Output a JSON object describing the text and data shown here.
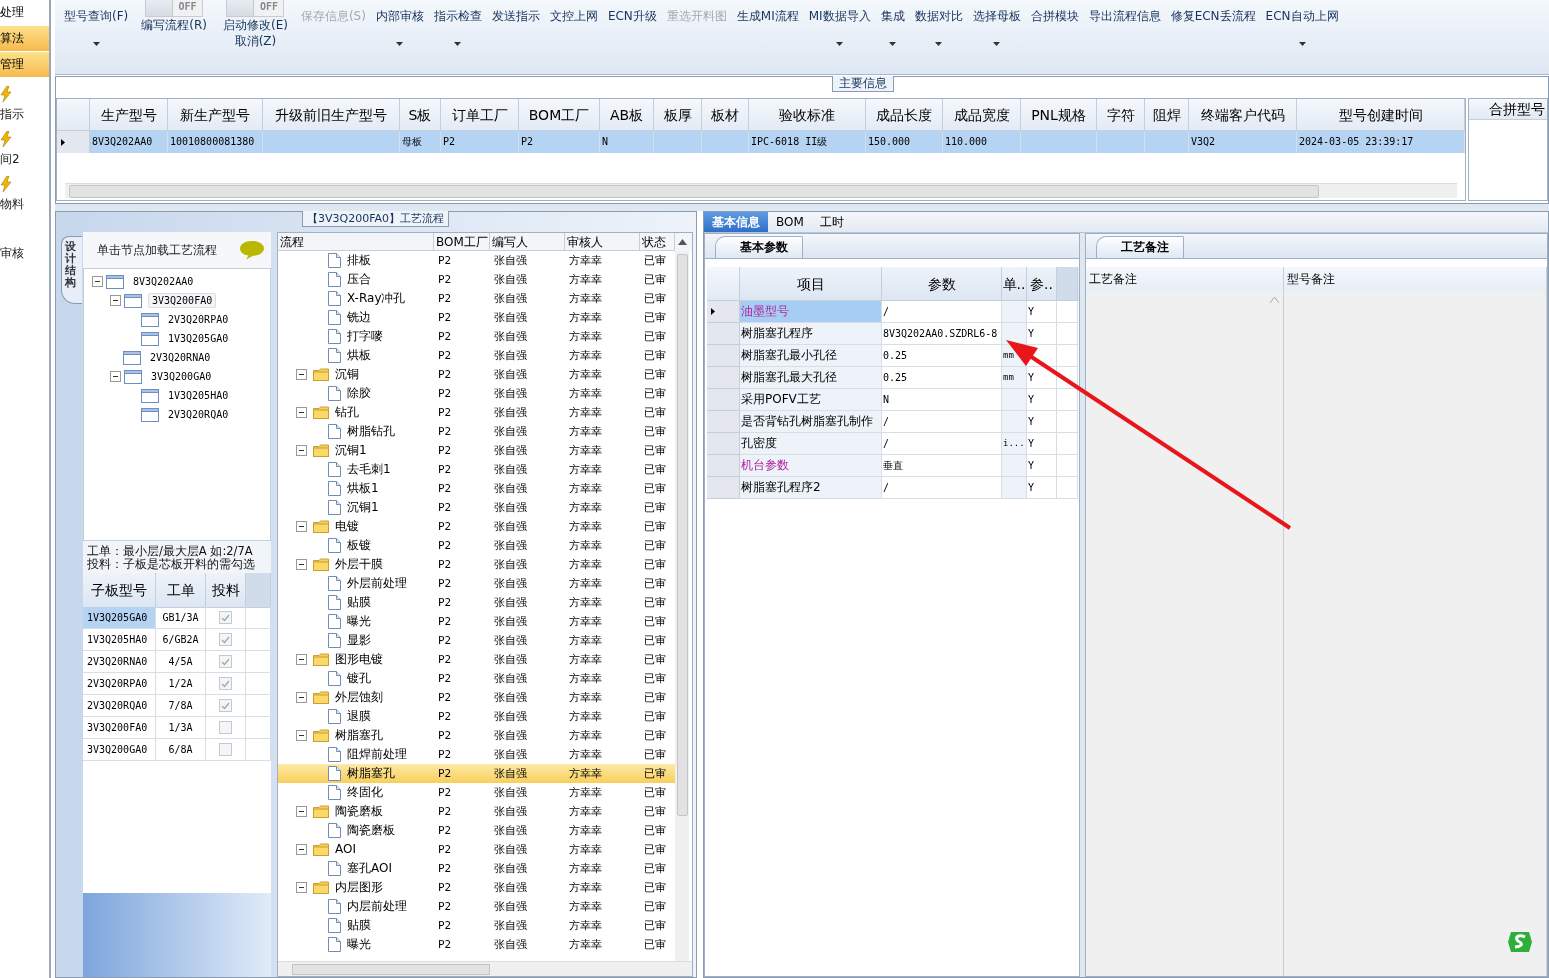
{
  "side_strip": {
    "menu": [
      {
        "label": "处理",
        "highlighted": false
      },
      {
        "label": "算法",
        "highlighted": true
      },
      {
        "label": "管理",
        "highlighted": true
      }
    ],
    "tasks": [
      {
        "label": "指示",
        "icon": true
      },
      {
        "label": "间2",
        "icon": true
      },
      {
        "label": "物料",
        "icon": true
      },
      {
        "label": "审核",
        "icon": false
      }
    ]
  },
  "toolbar": [
    {
      "kind": "button",
      "label": "型号查询(F)",
      "menu": true,
      "disabled": false
    },
    {
      "kind": "toggle",
      "switch": "OFF",
      "on": false,
      "label": "编写流程(R)"
    },
    {
      "kind": "toggle",
      "switch": "OFF",
      "on": false,
      "label": "启动修改(E)",
      "sublabel": "取消(Z)"
    },
    {
      "kind": "button",
      "label": "保存信息(S)",
      "menu": false,
      "disabled": true
    },
    {
      "kind": "button",
      "label": "内部审核",
      "menu": true,
      "disabled": false
    },
    {
      "kind": "button",
      "label": "指示检查",
      "menu": true,
      "disabled": false
    },
    {
      "kind": "button",
      "label": "发送指示",
      "menu": false,
      "disabled": false
    },
    {
      "kind": "button",
      "label": "文控上网",
      "menu": false,
      "disabled": false
    },
    {
      "kind": "button",
      "label": "ECN升级",
      "menu": false,
      "disabled": false
    },
    {
      "kind": "button",
      "label": "重选开料图",
      "menu": false,
      "disabled": true
    },
    {
      "kind": "button",
      "label": "生成MI流程",
      "menu": false,
      "disabled": false
    },
    {
      "kind": "button",
      "label": "MI数据导入",
      "menu": true,
      "disabled": false
    },
    {
      "kind": "button",
      "label": "集成",
      "menu": true,
      "disabled": false
    },
    {
      "kind": "button",
      "label": "数据对比",
      "menu": true,
      "disabled": false
    },
    {
      "kind": "button",
      "label": "选择母板",
      "menu": true,
      "disabled": false
    },
    {
      "kind": "button",
      "label": "合拼模块",
      "menu": false,
      "disabled": false
    },
    {
      "kind": "button",
      "label": "导出流程信息",
      "menu": false,
      "disabled": false
    },
    {
      "kind": "button",
      "label": "修复ECN丢流程",
      "menu": false,
      "disabled": false
    },
    {
      "kind": "button",
      "label": "ECN自动上网",
      "menu": true,
      "disabled": false
    }
  ],
  "main_info": {
    "title": "主要信息",
    "columns": [
      "生产型号",
      "新生产型号",
      "升级前旧生产型号",
      "S板",
      "订单工厂",
      "BOM工厂",
      "AB板",
      "板厚",
      "板材",
      "验收标准",
      "成品长度",
      "成品宽度",
      "PNL规格",
      "字符",
      "阻焊",
      "终端客户代码",
      "型号创建时间"
    ],
    "rows": [
      {
        "selected": true,
        "cells": [
          "8V3Q202AA0",
          "10010800081380",
          "",
          "母板",
          "P2",
          "P2",
          "N",
          "",
          "",
          "IPC-6018 II级",
          "150.000",
          "110.000",
          "",
          "",
          "",
          "V3Q2",
          "2024-03-05 23:39:17"
        ]
      }
    ],
    "side_column": "合拼型号"
  },
  "structure_panel": {
    "tab": "设计结构",
    "hint": "单击节点加载工艺流程",
    "tree": [
      {
        "label": "8V3Q202AA0",
        "expanded": true,
        "selected": false,
        "children": [
          {
            "label": "3V3Q200FA0",
            "expanded": true,
            "selected": true,
            "children": [
              {
                "label": "2V3Q20RPA0",
                "selected": false
              },
              {
                "label": "1V3Q205GA0",
                "selected": false
              }
            ]
          },
          {
            "label": "2V3Q20RNA0",
            "selected": false
          },
          {
            "label": "3V3Q200GA0",
            "expanded": true,
            "selected": false,
            "children": [
              {
                "label": "1V3Q205HA0",
                "selected": false
              },
              {
                "label": "2V3Q20RQA0",
                "selected": false
              }
            ]
          }
        ]
      }
    ],
    "notes": [
      "工单：最小层/最大层A 如:2/7A",
      "投料：子板是芯板开料的需勾选"
    ],
    "columns": [
      "子板型号",
      "工单",
      "投料"
    ],
    "rows": [
      {
        "board": "1V3Q205GA0",
        "order": "GB1/3A",
        "checked": true,
        "selected": true
      },
      {
        "board": "1V3Q205HA0",
        "order": "6/GB2A",
        "checked": true,
        "selected": false
      },
      {
        "board": "2V3Q20RNA0",
        "order": "4/5A",
        "checked": true,
        "selected": false
      },
      {
        "board": "2V3Q20RPA0",
        "order": "1/2A",
        "checked": true,
        "selected": false
      },
      {
        "board": "2V3Q20RQA0",
        "order": "7/8A",
        "checked": true,
        "selected": false
      },
      {
        "board": "3V3Q200FA0",
        "order": "1/3A",
        "checked": false,
        "selected": false
      },
      {
        "board": "3V3Q200GA0",
        "order": "6/8A",
        "checked": false,
        "selected": false
      }
    ]
  },
  "flow": {
    "title": "【3V3Q200FA0】工艺流程",
    "columns": [
      "流程",
      "BOM工厂",
      "编写人",
      "审核人",
      "状态"
    ],
    "items": [
      {
        "kind": "step",
        "name": "排板",
        "factory": "P2",
        "author": "张自强",
        "reviewer": "方幸幸",
        "status": "已审",
        "selected": false
      },
      {
        "kind": "step",
        "name": "压合",
        "factory": "P2",
        "author": "张自强",
        "reviewer": "方幸幸",
        "status": "已审",
        "selected": false
      },
      {
        "kind": "step",
        "name": "X-Ray冲孔",
        "factory": "P2",
        "author": "张自强",
        "reviewer": "方幸幸",
        "status": "已审",
        "selected": false
      },
      {
        "kind": "step",
        "name": "铣边",
        "factory": "P2",
        "author": "张自强",
        "reviewer": "方幸幸",
        "status": "已审",
        "selected": false
      },
      {
        "kind": "step",
        "name": "打字嘜",
        "factory": "P2",
        "author": "张自强",
        "reviewer": "方幸幸",
        "status": "已审",
        "selected": false
      },
      {
        "kind": "step",
        "name": "烘板",
        "factory": "P2",
        "author": "张自强",
        "reviewer": "方幸幸",
        "status": "已审",
        "selected": false
      },
      {
        "kind": "group",
        "name": "沉铜",
        "factory": "P2",
        "author": "张自强",
        "reviewer": "方幸幸",
        "status": "已审",
        "selected": false,
        "expanded": true,
        "children": [
          {
            "kind": "step",
            "name": "除胶",
            "factory": "P2",
            "author": "张自强",
            "reviewer": "方幸幸",
            "status": "已审",
            "selected": false
          }
        ]
      },
      {
        "kind": "group",
        "name": "钻孔",
        "factory": "P2",
        "author": "张自强",
        "reviewer": "方幸幸",
        "status": "已审",
        "selected": false,
        "expanded": true,
        "children": [
          {
            "kind": "step",
            "name": "树脂钻孔",
            "factory": "P2",
            "author": "张自强",
            "reviewer": "方幸幸",
            "status": "已审",
            "selected": false
          }
        ]
      },
      {
        "kind": "group",
        "name": "沉铜1",
        "factory": "P2",
        "author": "张自强",
        "reviewer": "方幸幸",
        "status": "已审",
        "selected": false,
        "expanded": true,
        "children": [
          {
            "kind": "step",
            "name": "去毛刺1",
            "factory": "P2",
            "author": "张自强",
            "reviewer": "方幸幸",
            "status": "已审",
            "selected": false
          },
          {
            "kind": "step",
            "name": "烘板1",
            "factory": "P2",
            "author": "张自强",
            "reviewer": "方幸幸",
            "status": "已审",
            "selected": false
          },
          {
            "kind": "step",
            "name": "沉铜1",
            "factory": "P2",
            "author": "张自强",
            "reviewer": "方幸幸",
            "status": "已审",
            "selected": false
          }
        ]
      },
      {
        "kind": "group",
        "name": "电镀",
        "factory": "P2",
        "author": "张自强",
        "reviewer": "方幸幸",
        "status": "已审",
        "selected": false,
        "expanded": true,
        "children": [
          {
            "kind": "step",
            "name": "板镀",
            "factory": "P2",
            "author": "张自强",
            "reviewer": "方幸幸",
            "status": "已审",
            "selected": false
          }
        ]
      },
      {
        "kind": "group",
        "name": "外层干膜",
        "factory": "P2",
        "author": "张自强",
        "reviewer": "方幸幸",
        "status": "已审",
        "selected": false,
        "expanded": true,
        "children": [
          {
            "kind": "step",
            "name": "外层前处理",
            "factory": "P2",
            "author": "张自强",
            "reviewer": "方幸幸",
            "status": "已审",
            "selected": false
          },
          {
            "kind": "step",
            "name": "贴膜",
            "factory": "P2",
            "author": "张自强",
            "reviewer": "方幸幸",
            "status": "已审",
            "selected": false
          },
          {
            "kind": "step",
            "name": "曝光",
            "factory": "P2",
            "author": "张自强",
            "reviewer": "方幸幸",
            "status": "已审",
            "selected": false
          },
          {
            "kind": "step",
            "name": "显影",
            "factory": "P2",
            "author": "张自强",
            "reviewer": "方幸幸",
            "status": "已审",
            "selected": false
          }
        ]
      },
      {
        "kind": "group",
        "name": "图形电镀",
        "factory": "P2",
        "author": "张自强",
        "reviewer": "方幸幸",
        "status": "已审",
        "selected": false,
        "expanded": true,
        "children": [
          {
            "kind": "step",
            "name": "镀孔",
            "factory": "P2",
            "author": "张自强",
            "reviewer": "方幸幸",
            "status": "已审",
            "selected": false
          }
        ]
      },
      {
        "kind": "group",
        "name": "外层蚀刻",
        "factory": "P2",
        "author": "张自强",
        "reviewer": "方幸幸",
        "status": "已审",
        "selected": false,
        "expanded": true,
        "children": [
          {
            "kind": "step",
            "name": "退膜",
            "factory": "P2",
            "author": "张自强",
            "reviewer": "方幸幸",
            "status": "已审",
            "selected": false
          }
        ]
      },
      {
        "kind": "group",
        "name": "树脂塞孔",
        "factory": "P2",
        "author": "张自强",
        "reviewer": "方幸幸",
        "status": "已审",
        "selected": false,
        "expanded": true,
        "children": [
          {
            "kind": "step",
            "name": "阻焊前处理",
            "factory": "P2",
            "author": "张自强",
            "reviewer": "方幸幸",
            "status": "已审",
            "selected": false
          },
          {
            "kind": "step",
            "name": "树脂塞孔",
            "factory": "P2",
            "author": "张自强",
            "reviewer": "方幸幸",
            "status": "已审",
            "selected": true
          },
          {
            "kind": "step",
            "name": "终固化",
            "factory": "P2",
            "author": "张自强",
            "reviewer": "方幸幸",
            "status": "已审",
            "selected": false
          }
        ]
      },
      {
        "kind": "group",
        "name": "陶瓷磨板",
        "factory": "P2",
        "author": "张自强",
        "reviewer": "方幸幸",
        "status": "已审",
        "selected": false,
        "expanded": true,
        "children": [
          {
            "kind": "step",
            "name": "陶瓷磨板",
            "factory": "P2",
            "author": "张自强",
            "reviewer": "方幸幸",
            "status": "已审",
            "selected": false
          }
        ]
      },
      {
        "kind": "group",
        "name": "AOI",
        "factory": "P2",
        "author": "张自强",
        "reviewer": "方幸幸",
        "status": "已审",
        "selected": false,
        "expanded": true,
        "children": [
          {
            "kind": "step",
            "name": "塞孔AOI",
            "factory": "P2",
            "author": "张自强",
            "reviewer": "方幸幸",
            "status": "已审",
            "selected": false
          }
        ]
      },
      {
        "kind": "group",
        "name": "内层图形",
        "factory": "P2",
        "author": "张自强",
        "reviewer": "方幸幸",
        "status": "已审",
        "selected": false,
        "expanded": true,
        "children": [
          {
            "kind": "step",
            "name": "内层前处理",
            "factory": "P2",
            "author": "张自强",
            "reviewer": "方幸幸",
            "status": "已审",
            "selected": false
          },
          {
            "kind": "step",
            "name": "贴膜",
            "factory": "P2",
            "author": "张自强",
            "reviewer": "方幸幸",
            "status": "已审",
            "selected": false
          },
          {
            "kind": "step",
            "name": "曝光",
            "factory": "P2",
            "author": "张自强",
            "reviewer": "方幸幸",
            "status": "已审",
            "selected": false
          }
        ]
      }
    ]
  },
  "detail_tabs": [
    {
      "label": "基本信息",
      "selected": true
    },
    {
      "label": "BOM",
      "selected": false
    },
    {
      "label": "工时",
      "selected": false
    }
  ],
  "params": {
    "tab": "基本参数",
    "columns": [
      "项目",
      "参数",
      "单..",
      "参.."
    ],
    "rows": [
      {
        "item": "油墨型号",
        "value": "/",
        "unit": "",
        "flag": "Y",
        "emphasized": true,
        "selected": true
      },
      {
        "item": "树脂塞孔程序",
        "value": "8V3Q202AA0.SZDRL6-8",
        "unit": "",
        "flag": "Y",
        "emphasized": false,
        "selected": false
      },
      {
        "item": "树脂塞孔最小孔径",
        "value": "0.25",
        "unit": "mm",
        "emphasized": false,
        "selected": false
      },
      {
        "item": "树脂塞孔最大孔径",
        "value": "0.25",
        "unit": "mm",
        "flag": "Y",
        "emphasized": false,
        "selected": false
      },
      {
        "item": "采用POFV工艺",
        "value": "N",
        "unit": "",
        "flag": "Y",
        "emphasized": false,
        "selected": false
      },
      {
        "item": "是否背钻孔树脂塞孔制作",
        "value": "/",
        "unit": "",
        "flag": "Y",
        "emphasized": false,
        "selected": false
      },
      {
        "item": "孔密度",
        "value": "/",
        "unit": "i...",
        "flag": "Y",
        "emphasized": false,
        "selected": false
      },
      {
        "item": "机台参数",
        "value": "垂直",
        "unit": "",
        "flag": "Y",
        "emphasized": true,
        "selected": false
      },
      {
        "item": "树脂塞孔程序2",
        "value": "/",
        "unit": "",
        "flag": "Y",
        "emphasized": false,
        "selected": false
      }
    ]
  },
  "remarks": {
    "tab": "工艺备注",
    "columns": [
      "工艺备注",
      "型号备注"
    ]
  }
}
